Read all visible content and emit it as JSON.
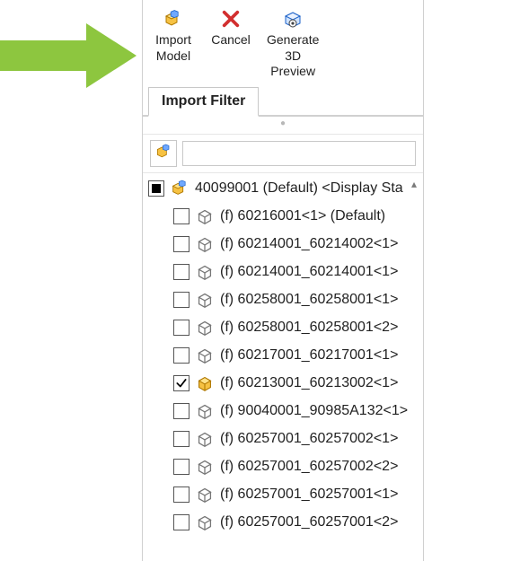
{
  "toolbar": {
    "import_model_label": "Import\nModel",
    "cancel_label": "Cancel",
    "generate_preview_label": "Generate\n3D\nPreview"
  },
  "tab": {
    "import_filter": "Import Filter"
  },
  "filter": {
    "placeholder": ""
  },
  "tree": {
    "root": {
      "label": "40099001 (Default) <Display Sta",
      "checked": "partial",
      "iconKind": "assembly"
    },
    "items": [
      {
        "label": "(f) 60216001<1> (Default)",
        "checked": false,
        "iconKind": "part-outline"
      },
      {
        "label": "(f) 60214001_60214002<1>",
        "checked": false,
        "iconKind": "part-outline"
      },
      {
        "label": "(f) 60214001_60214001<1>",
        "checked": false,
        "iconKind": "part-outline"
      },
      {
        "label": "(f) 60258001_60258001<1>",
        "checked": false,
        "iconKind": "part-outline"
      },
      {
        "label": "(f) 60258001_60258001<2>",
        "checked": false,
        "iconKind": "part-outline"
      },
      {
        "label": "(f) 60217001_60217001<1>",
        "checked": false,
        "iconKind": "part-outline"
      },
      {
        "label": "(f) 60213001_60213002<1>",
        "checked": true,
        "iconKind": "part-solid"
      },
      {
        "label": "(f) 90040001_90985A132<1>",
        "checked": false,
        "iconKind": "part-outline"
      },
      {
        "label": "(f) 60257001_60257002<1>",
        "checked": false,
        "iconKind": "part-outline"
      },
      {
        "label": "(f) 60257001_60257002<2>",
        "checked": false,
        "iconKind": "part-outline"
      },
      {
        "label": "(f) 60257001_60257001<1>",
        "checked": false,
        "iconKind": "part-outline"
      },
      {
        "label": "(f) 60257001_60257001<2>",
        "checked": false,
        "iconKind": "part-outline"
      }
    ]
  },
  "colors": {
    "arrow": "#8dc63f",
    "cancel": "#d22f2f",
    "accent_yellow": "#f4c430",
    "accent_blue": "#1b61c8"
  }
}
